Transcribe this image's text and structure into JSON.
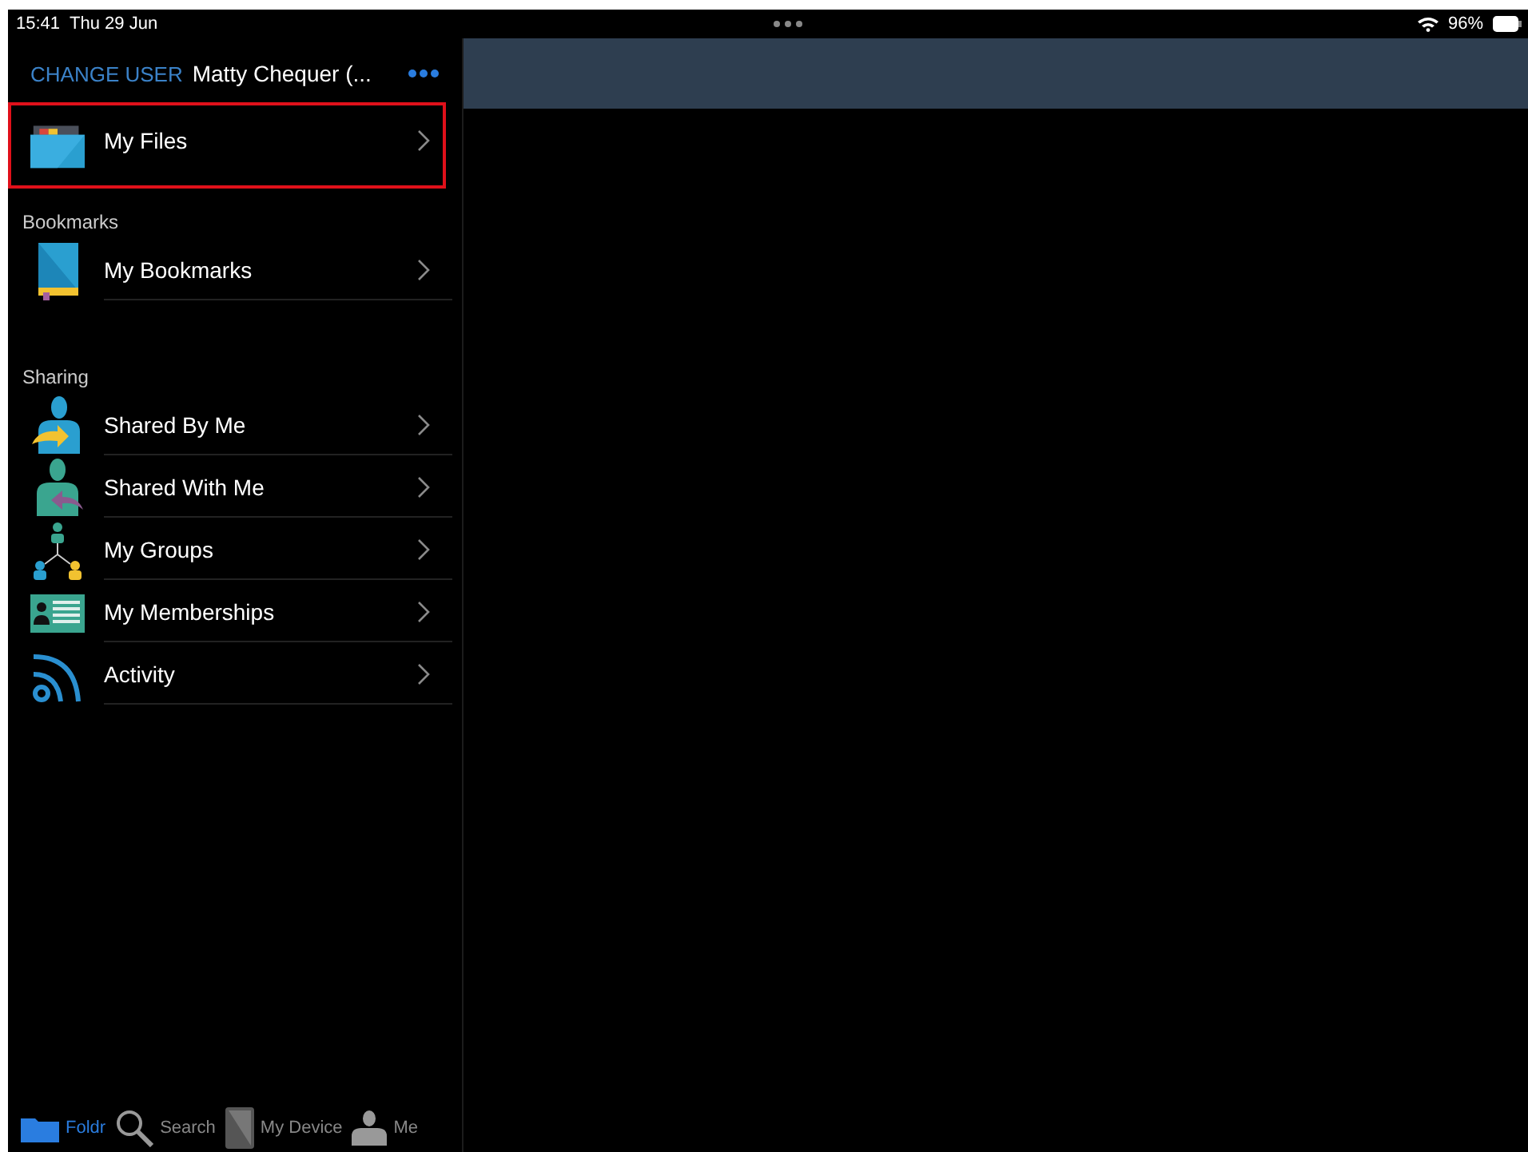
{
  "status_bar": {
    "time": "15:41",
    "date": "Thu 29 Jun",
    "battery": "96%"
  },
  "header": {
    "action": "CHANGE USER",
    "user": "Matty Chequer (..."
  },
  "top_item": {
    "label": "My Files",
    "highlighted": true
  },
  "sections": [
    {
      "title": "Bookmarks",
      "items": [
        {
          "label": "My Bookmarks"
        }
      ]
    },
    {
      "title": "Sharing",
      "items": [
        {
          "label": "Shared By Me"
        },
        {
          "label": "Shared With Me"
        },
        {
          "label": "My Groups"
        },
        {
          "label": "My Memberships"
        },
        {
          "label": "Activity"
        }
      ]
    }
  ],
  "tab_bar": [
    {
      "label": "Foldr",
      "selected": true
    },
    {
      "label": "Search",
      "selected": false
    },
    {
      "label": "My Device",
      "selected": false
    },
    {
      "label": "Me",
      "selected": false
    }
  ]
}
